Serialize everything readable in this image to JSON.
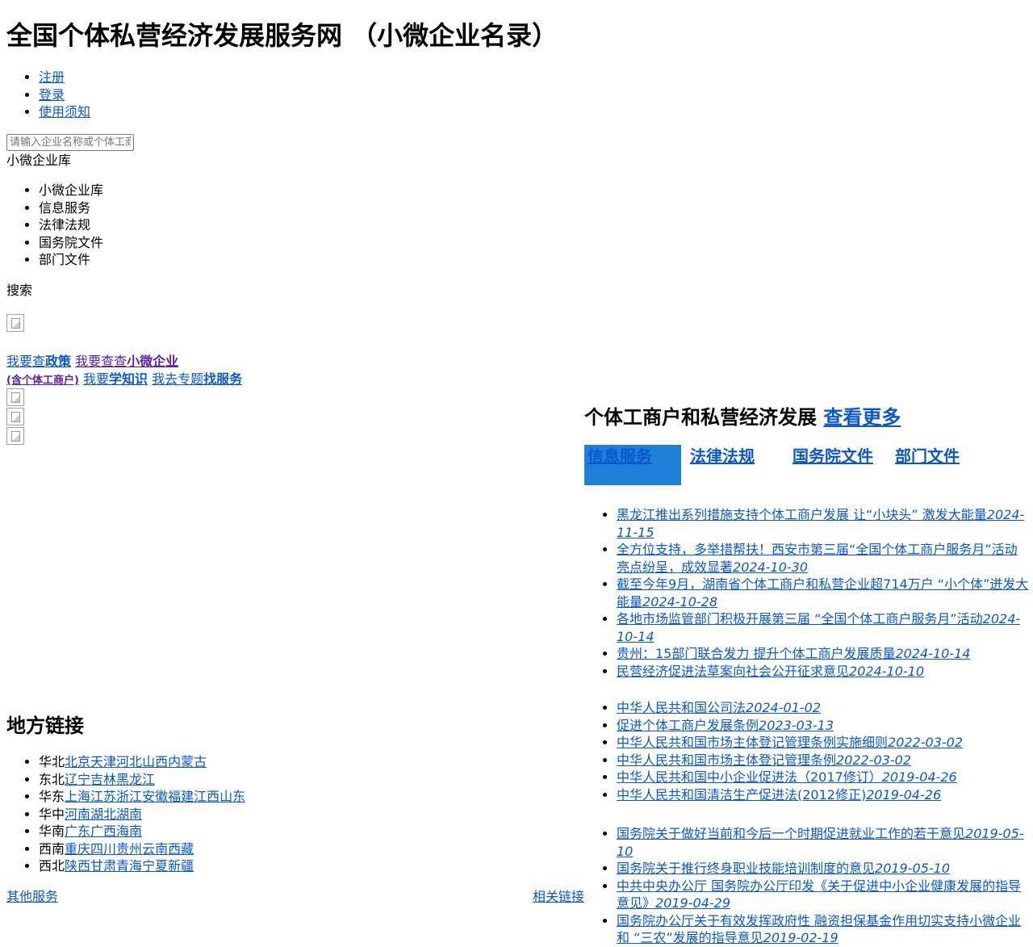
{
  "site": {
    "title": "全国个体私营经济发展服务网 （小微企业名录）"
  },
  "topnav": {
    "items": [
      "注册",
      "登录",
      "使用须知"
    ]
  },
  "search": {
    "placeholder": "请输入企业名称或个体工商户名称",
    "category_current": "小微企业库",
    "label": "搜索"
  },
  "categories": [
    "小微企业库",
    "信息服务",
    "法律法规",
    "国务院文件",
    "部门文件"
  ],
  "quick_links": {
    "policy_a": "我要查",
    "policy_b": "政策",
    "company_a": "我要查查",
    "company_b": "小微企业",
    "company_c": "(含个体工商户)",
    "learn_a": "我要",
    "learn_b": "学知识",
    "service_a": "我去专题",
    "service_b": "找服务"
  },
  "news": {
    "heading": "个体工商户和私营经济发展",
    "more": "查看更多",
    "tabs": [
      "信息服务",
      "法律法规",
      "国务院文件",
      "部门文件"
    ],
    "info": [
      {
        "title": "黑龙江推出系列措施支持个体工商户发展 让“小块头” 激发大能量",
        "date": "2024-11-15"
      },
      {
        "title": "全方位支持，多举措帮扶！西安市第三届“全国个体工商户服务月”活动亮点纷呈，成效显著",
        "date": "2024-10-30"
      },
      {
        "title": "截至今年9月，湖南省个体工商户和私营企业超714万户 “小个体”迸发大能量",
        "date": "2024-10-28"
      },
      {
        "title": "各地市场监管部门积极开展第三届 “全国个体工商户服务月”活动",
        "date": "2024-10-14"
      },
      {
        "title": "贵州：15部门联合发力 提升个体工商户发展质量",
        "date": "2024-10-14"
      },
      {
        "title": "民营经济促进法草案向社会公开征求意见",
        "date": "2024-10-10"
      }
    ],
    "laws": [
      {
        "title": "中华人民共和国公司法",
        "date": "2024-01-02"
      },
      {
        "title": "促进个体工商户发展条例",
        "date": "2023-03-13"
      },
      {
        "title": "中华人民共和国市场主体登记管理条例实施细则",
        "date": "2022-03-02"
      },
      {
        "title": "中华人民共和国市场主体登记管理条例",
        "date": "2022-03-02"
      },
      {
        "title": "中华人民共和国中小企业促进法（2017修订）",
        "date": "2019-04-26"
      },
      {
        "title": "中华人民共和国清洁生产促进法(2012修正)",
        "date": "2019-04-26"
      }
    ],
    "state": [
      {
        "title": "国务院关于做好当前和今后一个时期促进就业工作的若干意见",
        "date": "2019-05-10"
      },
      {
        "title": "国务院关于推行终身职业技能培训制度的意见",
        "date": "2019-05-10"
      },
      {
        "title": "中共中央办公厅 国务院办公厅印发《关于促进中小企业健康发展的指导意见》",
        "date": "2019-04-29"
      },
      {
        "title": "国务院办公厅关于有效发挥政府性 融资担保基金作用切实支持小微企业和 “三农”发展的指导意见",
        "date": "2019-02-19"
      }
    ]
  },
  "regions": {
    "heading": "地方链接",
    "groups": [
      {
        "name": "华北",
        "places": [
          "北京",
          "天津",
          "河北",
          "山西",
          "内蒙古"
        ]
      },
      {
        "name": "东北",
        "places": [
          "辽宁",
          "吉林",
          "黑龙江"
        ]
      },
      {
        "name": "华东",
        "places": [
          "上海",
          "江苏",
          "浙江",
          "安徽",
          "福建",
          "江西",
          "山东"
        ]
      },
      {
        "name": "华中",
        "places": [
          "河南",
          "湖北",
          "湖南"
        ]
      },
      {
        "name": "华南",
        "places": [
          "广东",
          "广西",
          "海南"
        ]
      },
      {
        "name": "西南",
        "places": [
          "重庆",
          "四川",
          "贵州",
          "云南",
          "西藏"
        ]
      },
      {
        "name": "西北",
        "places": [
          "陕西",
          "甘肃",
          "青海",
          "宁夏",
          "新疆"
        ]
      }
    ]
  },
  "footer": {
    "other_services": "其他服务",
    "related_links": "相关链接"
  }
}
